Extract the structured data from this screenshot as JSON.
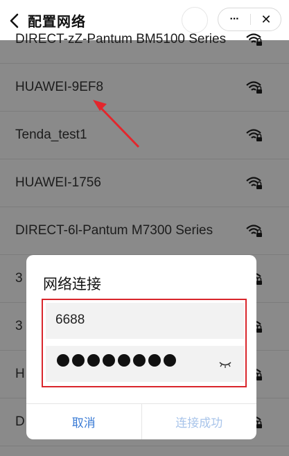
{
  "header": {
    "title": "配置网络",
    "more_label": "···",
    "close_label": "✕"
  },
  "networks": [
    {
      "ssid": "DIRECT-zZ-Pantum BM5100 Series"
    },
    {
      "ssid": "HUAWEI-9EF8"
    },
    {
      "ssid": "Tenda_test1"
    },
    {
      "ssid": "HUAWEI-1756"
    },
    {
      "ssid": "DIRECT-6l-Pantum M7300 Series"
    },
    {
      "ssid": "3"
    },
    {
      "ssid": "3"
    },
    {
      "ssid": "H"
    },
    {
      "ssid": "D"
    }
  ],
  "dialog": {
    "title": "网络连接",
    "ssid_value": "6688",
    "password_dot_count": 8,
    "cancel_label": "取消",
    "confirm_label": "连接成功"
  },
  "colors": {
    "accent": "#3a7bd5",
    "annotation": "#d9252b",
    "overlay": "#8a8a8a"
  },
  "icons": {
    "back": "chevron-left-icon",
    "wifi": "wifi-lock-icon",
    "eye": "eye-closed-icon"
  }
}
